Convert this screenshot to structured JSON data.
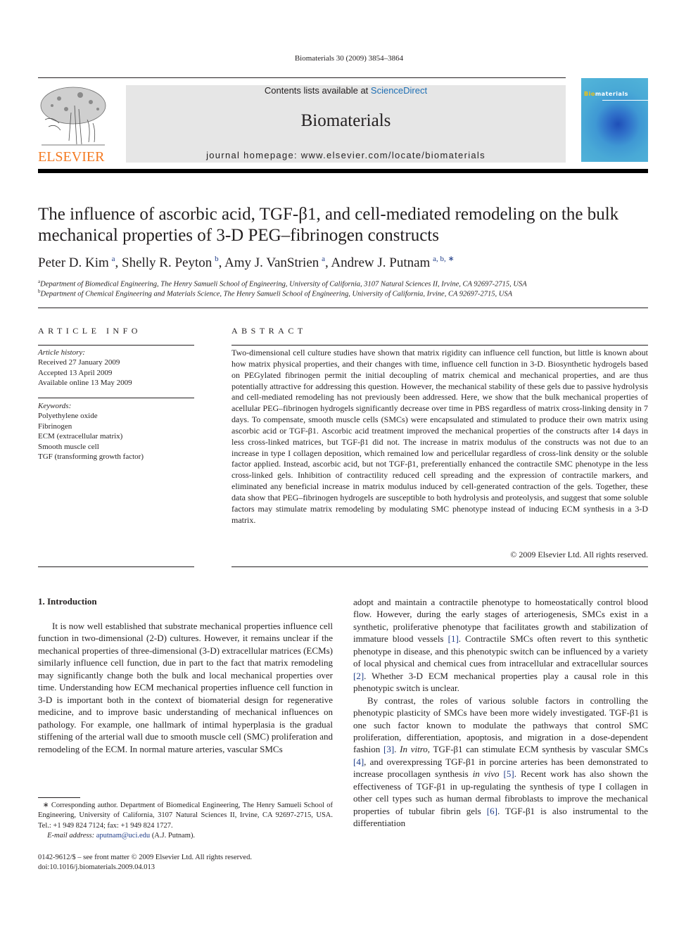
{
  "running_header": "Biomaterials 30 (2009) 3854–3864",
  "publisher": {
    "logo_text": "ELSEVIER",
    "logo_color": "#f47920"
  },
  "banner": {
    "contents_prefix": "Contents lists available at ",
    "contents_link": "ScienceDirect",
    "journal_title": "Biomaterials",
    "homepage": "journal homepage: www.elsevier.com/locate/biomaterials"
  },
  "cover": {
    "title_bio": "Bio",
    "title_rest": "materials"
  },
  "article": {
    "title": "The influence of ascorbic acid, TGF-β1, and cell-mediated remodeling on the bulk mechanical properties of 3-D PEG–fibrinogen constructs",
    "authors": [
      {
        "name": "Peter D. Kim",
        "sup": "a"
      },
      {
        "name": "Shelly R. Peyton",
        "sup": "b"
      },
      {
        "name": "Amy J. VanStrien",
        "sup": "a"
      },
      {
        "name": "Andrew J. Putnam",
        "sup": "a, b, ∗"
      }
    ],
    "affiliations": [
      {
        "sup": "a",
        "text": "Department of Biomedical Engineering, The Henry Samueli School of Engineering, University of California, 3107 Natural Sciences II, Irvine, CA 92697-2715, USA"
      },
      {
        "sup": "b",
        "text": "Department of Chemical Engineering and Materials Science, The Henry Samueli School of Engineering, University of California, Irvine, CA 92697-2715, USA"
      }
    ]
  },
  "article_info": {
    "heading": "ARTICLE INFO",
    "history_label": "Article history:",
    "history": [
      "Received 27 January 2009",
      "Accepted 13 April 2009",
      "Available online 13 May 2009"
    ],
    "keywords_label": "Keywords:",
    "keywords": [
      "Polyethylene oxide",
      "Fibrinogen",
      "ECM (extracellular matrix)",
      "Smooth muscle cell",
      "TGF (transforming growth factor)"
    ]
  },
  "abstract": {
    "heading": "ABSTRACT",
    "text": "Two-dimensional cell culture studies have shown that matrix rigidity can influence cell function, but little is known about how matrix physical properties, and their changes with time, influence cell function in 3-D. Biosynthetic hydrogels based on PEGylated fibrinogen permit the initial decoupling of matrix chemical and mechanical properties, and are thus potentially attractive for addressing this question. However, the mechanical stability of these gels due to passive hydrolysis and cell-mediated remodeling has not previously been addressed. Here, we show that the bulk mechanical properties of acellular PEG–fibrinogen hydrogels significantly decrease over time in PBS regardless of matrix cross-linking density in 7 days. To compensate, smooth muscle cells (SMCs) were encapsulated and stimulated to produce their own matrix using ascorbic acid or TGF-β1. Ascorbic acid treatment improved the mechanical properties of the constructs after 14 days in less cross-linked matrices, but TGF-β1 did not. The increase in matrix modulus of the constructs was not due to an increase in type I collagen deposition, which remained low and pericellular regardless of cross-link density or the soluble factor applied. Instead, ascorbic acid, but not TGF-β1, preferentially enhanced the contractile SMC phenotype in the less cross-linked gels. Inhibition of contractility reduced cell spreading and the expression of contractile markers, and eliminated any beneficial increase in matrix modulus induced by cell-generated contraction of the gels. Together, these data show that PEG–fibrinogen hydrogels are susceptible to both hydrolysis and proteolysis, and suggest that some soluble factors may stimulate matrix remodeling by modulating SMC phenotype instead of inducing ECM synthesis in a 3-D matrix.",
    "copyright": "© 2009 Elsevier Ltd. All rights reserved."
  },
  "introduction": {
    "heading": "1.  Introduction",
    "col1_p1": "It is now well established that substrate mechanical properties influence cell function in two-dimensional (2-D) cultures. However, it remains unclear if the mechanical properties of three-dimensional (3-D) extracellular matrices (ECMs) similarly influence cell function, due in part to the fact that matrix remodeling may significantly change both the bulk and local mechanical properties over time. Understanding how ECM mechanical properties influence cell function in 3-D is important both in the context of biomaterial design for regenerative medicine, and to improve basic understanding of mechanical influences on pathology. For example, one hallmark of intimal hyperplasia is the gradual stiffening of the arterial wall due to smooth muscle cell (SMC) proliferation and remodeling of the ECM. In normal mature arteries, vascular SMCs",
    "col2_p1": [
      "adopt and maintain a contractile phenotype to homeostatically control blood flow. However, during the early stages of arteriogenesis, SMCs exist in a synthetic, proliferative phenotype that facilitates growth and stabilization of immature blood vessels ",
      "[1]",
      ". Contractile SMCs often revert to this synthetic phenotype in disease, and this phenotypic switch can be influenced by a variety of local physical and chemical cues from intracellular and extracellular sources ",
      "[2]",
      ". Whether 3-D ECM mechanical properties play a causal role in this phenotypic switch is unclear."
    ],
    "col2_p2": [
      "By contrast, the roles of various soluble factors in controlling the phenotypic plasticity of SMCs have been more widely investigated. TGF-β1 is one such factor known to modulate the pathways that control SMC proliferation, differentiation, apoptosis, and migration in a dose-dependent fashion ",
      "[3]",
      ". ",
      "In vitro",
      ", TGF-β1 can stimulate ECM synthesis by vascular SMCs ",
      "[4]",
      ", and overexpressing TGF-β1 in porcine arteries has been demonstrated to increase procollagen synthesis ",
      "in vivo",
      " ",
      "[5]",
      ". Recent work has also shown the effectiveness of TGF-β1 in up-regulating the synthesis of type I collagen in other cell types such as human dermal fibroblasts to improve the mechanical properties of tubular fibrin gels ",
      "[6]",
      ". TGF-β1 is also instrumental to the differentiation"
    ]
  },
  "footnote": {
    "marker": "∗",
    "text": "Corresponding author. Department of Biomedical Engineering, The Henry Samueli School of Engineering, University of California, 3107 Natural Sciences II, Irvine, CA 92697-2715, USA. Tel.: +1 949 824 7124; fax: +1 949 824 1727.",
    "email_label": "E-mail address:",
    "email": "aputnam@uci.edu",
    "email_suffix": " (A.J. Putnam)."
  },
  "bottom": {
    "issn": "0142-9612/$ – see front matter © 2009 Elsevier Ltd. All rights reserved.",
    "doi": "doi:10.1016/j.biomaterials.2009.04.013"
  }
}
